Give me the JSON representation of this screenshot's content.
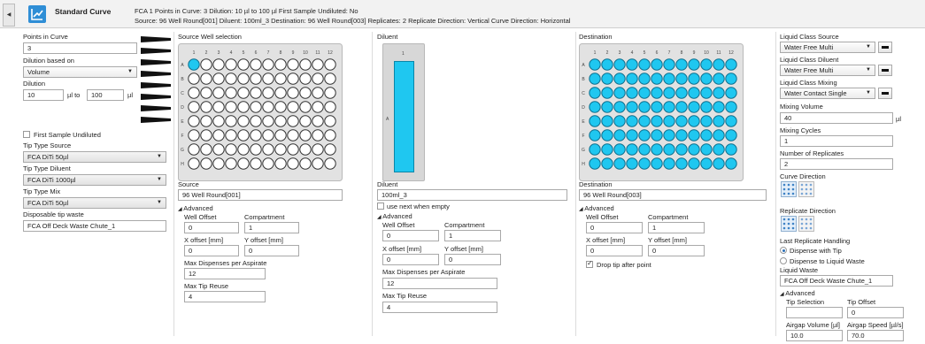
{
  "header": {
    "collapse_glyph": "◀",
    "icon": "standard-curve-icon",
    "title": "Standard Curve",
    "summary_line1": "FCA 1   Points in Curve: 3   Dilution: 10 µl to 100 µl   First Sample Undiluted: No",
    "summary_line2": "Source: 96 Well Round[001]   Diluent: 100ml_3   Destination: 96 Well Round[003]   Replicates: 2   Replicate Direction: Vertical   Curve Direction: Horizontal"
  },
  "left": {
    "points_label": "Points in Curve",
    "points_value": "3",
    "dilution_based_label": "Dilution based on",
    "dilution_based_value": "Volume",
    "dilution_label": "Dilution",
    "dilution_from": "10",
    "dilution_to_text": "µl to",
    "dilution_to": "100",
    "dilution_unit": "µl",
    "first_sample_label": "First Sample Undiluted",
    "tip_source_label": "Tip Type Source",
    "tip_source_value": "FCA DiTi 50µl",
    "tip_diluent_label": "Tip Type Diluent",
    "tip_diluent_value": "FCA DiTi 1000µl",
    "tip_mix_label": "Tip Type Mix",
    "tip_mix_value": "FCA DiTi 50µl",
    "waste_label": "Disposable tip waste",
    "waste_value": "FCA Off Deck Waste Chute_1"
  },
  "source": {
    "header": "Source Well selection",
    "label": "Source",
    "value": "96 Well Round[001]",
    "advanced": "Advanced",
    "well_offset_label": "Well Offset",
    "well_offset": "0",
    "compartment_label": "Compartment",
    "compartment": "1",
    "x_offset_label": "X offset [mm]",
    "x_offset": "0",
    "y_offset_label": "Y offset [mm]",
    "y_offset": "0",
    "max_disp_label": "Max Dispenses per Aspirate",
    "max_disp": "12",
    "max_tip_label": "Max Tip Reuse",
    "max_tip": "4"
  },
  "diluent": {
    "header": "Diluent",
    "col_label": "1",
    "row_label": "A",
    "label": "Diluent",
    "value": "100ml_3",
    "use_next_label": "use next when empty",
    "advanced": "Advanced",
    "well_offset_label": "Well Offset",
    "well_offset": "0",
    "compartment_label": "Compartment",
    "compartment": "1",
    "x_offset_label": "X offset [mm]",
    "x_offset": "0",
    "y_offset_label": "Y offset [mm]",
    "y_offset": "0",
    "max_disp_label": "Max Dispenses per Aspirate",
    "max_disp": "12",
    "max_tip_label": "Max Tip Reuse",
    "max_tip": "4"
  },
  "destination": {
    "header": "Destination",
    "label": "Destination",
    "value": "96 Well Round[003]",
    "advanced": "Advanced",
    "well_offset_label": "Well Offset",
    "well_offset": "0",
    "compartment_label": "Compartment",
    "compartment": "1",
    "x_offset_label": "X offset [mm]",
    "x_offset": "0",
    "y_offset_label": "Y offset [mm]",
    "y_offset": "0",
    "drop_tip_label": "Drop tip after point"
  },
  "plate": {
    "columns": [
      "1",
      "2",
      "3",
      "4",
      "5",
      "6",
      "7",
      "8",
      "9",
      "10",
      "11",
      "12"
    ],
    "rows": [
      "A",
      "B",
      "C",
      "D",
      "E",
      "F",
      "G",
      "H"
    ]
  },
  "right": {
    "lc_source_label": "Liquid Class Source",
    "lc_source_value": "Water Free Multi",
    "lc_diluent_label": "Liquid Class Diluent",
    "lc_diluent_value": "Water Free Multi",
    "lc_mixing_label": "Liquid Class Mixing",
    "lc_mixing_value": "Water Contact Single",
    "mixing_volume_label": "Mixing Volume",
    "mixing_volume": "40",
    "mixing_volume_unit": "µl",
    "mixing_cycles_label": "Mixing Cycles",
    "mixing_cycles": "1",
    "replicates_label": "Number of Replicates",
    "replicates": "2",
    "curve_dir_label": "Curve Direction",
    "replicate_dir_label": "Replicate Direction",
    "last_rep_label": "Last Replicate Handling",
    "dispense_tip_label": "Dispense with Tip",
    "dispense_waste_label": "Dispense to Liquid Waste",
    "liquid_waste_label": "Liquid Waste",
    "liquid_waste_value": "FCA Off Deck Waste Chute_1",
    "advanced": "Advanced",
    "tip_selection_label": "Tip Selection",
    "tip_offset_label": "Tip Offset",
    "tip_offset": "0",
    "airgap_volume_label": "Airgap Volume [µl]",
    "airgap_volume": "10.0",
    "airgap_speed_label": "Airgap Speed [µl/s]",
    "airgap_speed": "70.0"
  },
  "colors": {
    "well_selected": "#1fc7f0",
    "accent": "#2f8ed6"
  }
}
